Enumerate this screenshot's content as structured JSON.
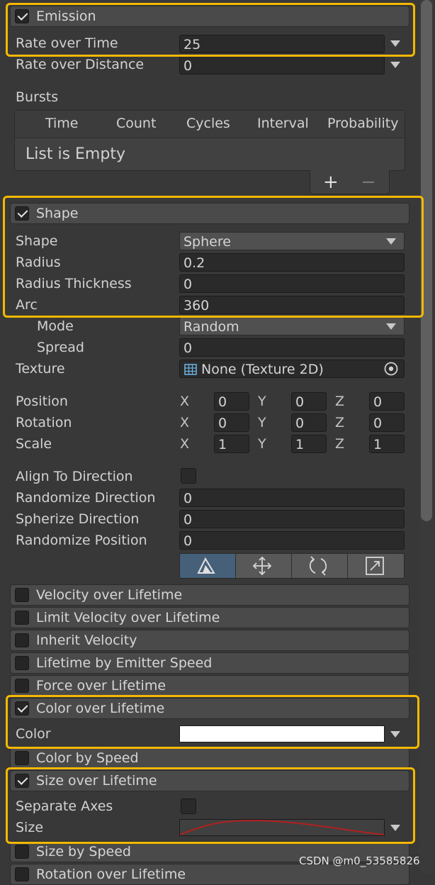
{
  "emission": {
    "title": "Emission",
    "rate_over_time_label": "Rate over Time",
    "rate_over_time_value": "25",
    "rate_over_distance_label": "Rate over Distance",
    "rate_over_distance_value": "0",
    "bursts_label": "Bursts",
    "bursts_columns": [
      "Time",
      "Count",
      "Cycles",
      "Interval",
      "Probability"
    ],
    "bursts_empty": "List is Empty",
    "add_glyph": "+",
    "remove_glyph": "−"
  },
  "shape": {
    "title": "Shape",
    "shape_label": "Shape",
    "shape_value": "Sphere",
    "radius_label": "Radius",
    "radius_value": "0.2",
    "radius_thickness_label": "Radius Thickness",
    "radius_thickness_value": "0",
    "arc_label": "Arc",
    "arc_value": "360",
    "mode_label": "Mode",
    "mode_value": "Random",
    "spread_label": "Spread",
    "spread_value": "0",
    "texture_label": "Texture",
    "texture_value": "None (Texture 2D)",
    "position_label": "Position",
    "rotation_label": "Rotation",
    "scale_label": "Scale",
    "axis_x": "X",
    "axis_y": "Y",
    "axis_z": "Z",
    "position": [
      "0",
      "0",
      "0"
    ],
    "rotation": [
      "0",
      "0",
      "0"
    ],
    "scale": [
      "1",
      "1",
      "1"
    ],
    "align_to_direction_label": "Align To Direction",
    "randomize_direction_label": "Randomize Direction",
    "randomize_direction_value": "0",
    "spherize_direction_label": "Spherize Direction",
    "spherize_direction_value": "0",
    "randomize_position_label": "Randomize Position",
    "randomize_position_value": "0"
  },
  "modules": {
    "velocity_over_lifetime": "Velocity over Lifetime",
    "limit_velocity_over_lifetime": "Limit Velocity over Lifetime",
    "inherit_velocity": "Inherit Velocity",
    "lifetime_by_emitter_speed": "Lifetime by Emitter Speed",
    "force_over_lifetime": "Force over Lifetime",
    "color_over_lifetime": "Color over Lifetime",
    "color_label": "Color",
    "color_by_speed": "Color by Speed",
    "size_over_lifetime": "Size over Lifetime",
    "separate_axes_label": "Separate Axes",
    "size_label": "Size",
    "size_by_speed": "Size by Speed",
    "rotation_over_lifetime": "Rotation over Lifetime"
  },
  "watermark": "CSDN @m0_53585826",
  "colors": {
    "highlight": "#f5b800",
    "curve": "#b02020",
    "gradient": "#ffffff"
  }
}
